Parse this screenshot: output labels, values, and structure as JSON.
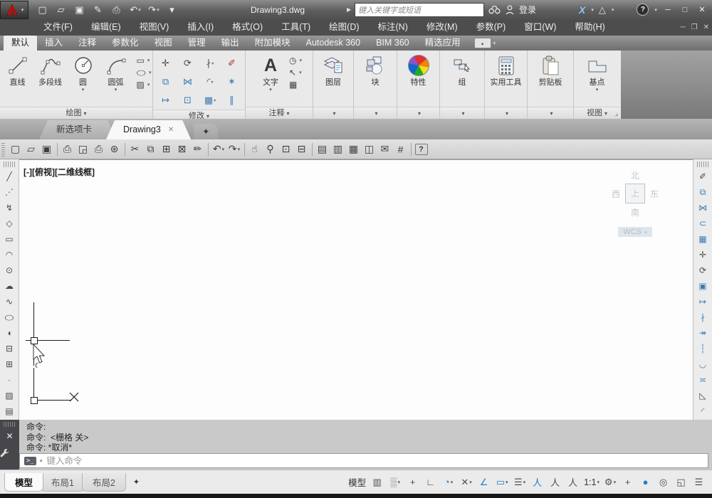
{
  "icons": {
    "caret": "▾",
    "corner": "⌟",
    "star": "✦",
    "ribbon_collapse": "▴",
    "prompt": "&gt;_",
    "prompt_text": ">_",
    "expand_arrow": "▶"
  },
  "titlebar": {
    "title": "Drawing3.dwg",
    "search_placeholder": "键入关键字或短语",
    "signin": "登录",
    "quick_access": [
      {
        "name": "new-file-icon",
        "glyph": "▢"
      },
      {
        "name": "open-file-icon",
        "glyph": "▱"
      },
      {
        "name": "save-icon",
        "glyph": "▣"
      },
      {
        "name": "save-as-icon",
        "glyph": "✎"
      },
      {
        "name": "print-icon",
        "glyph": "⎙"
      },
      {
        "name": "undo-icon",
        "glyph": "↶",
        "caret": "▾"
      },
      {
        "name": "redo-icon",
        "glyph": "↷",
        "caret": "▾"
      },
      {
        "name": "qat-customize-icon",
        "glyph": "▾"
      }
    ],
    "window_controls": [
      {
        "name": "minimize-button",
        "glyph": "─"
      },
      {
        "name": "maximize-button",
        "glyph": "□"
      },
      {
        "name": "close-button",
        "glyph": "✕"
      }
    ]
  },
  "menu": {
    "items": [
      "文件(F)",
      "编辑(E)",
      "视图(V)",
      "插入(I)",
      "格式(O)",
      "工具(T)",
      "绘图(D)",
      "标注(N)",
      "修改(M)",
      "参数(P)",
      "窗口(W)",
      "帮助(H)"
    ],
    "doc_controls": [
      {
        "name": "doc-minimize-button",
        "glyph": "─"
      },
      {
        "name": "doc-restore-button",
        "glyph": "❐"
      },
      {
        "name": "doc-close-button",
        "glyph": "✕"
      }
    ]
  },
  "ribbon": {
    "tabs": [
      {
        "label": "默认",
        "cls": "active"
      },
      {
        "label": "插入"
      },
      {
        "label": "注释"
      },
      {
        "label": "参数化"
      },
      {
        "label": "视图"
      },
      {
        "label": "管理"
      },
      {
        "label": "输出"
      },
      {
        "label": "附加模块"
      },
      {
        "label": "Autodesk 360"
      },
      {
        "label": "BIM 360"
      },
      {
        "label": "精选应用"
      }
    ],
    "panels": {
      "draw": {
        "label": "绘图",
        "line": "直线",
        "polyline": "多段线",
        "circle": "圆",
        "arc": "圆弧",
        "small": [
          {
            "name": "rectangle-icon",
            "glyph": "▭"
          },
          {
            "name": "ellipse-icon",
            "glyph": "◯",
            "cls": "squash"
          },
          {
            "name": "hatch-icon",
            "glyph": "▨"
          }
        ]
      },
      "modify": {
        "label": "修改",
        "tools": [
          {
            "name": "move-icon",
            "glyph": "✛"
          },
          {
            "name": "rotate-icon",
            "glyph": "⟳"
          },
          {
            "name": "trim-icon",
            "glyph": "∤",
            "caret": "▾"
          },
          {
            "name": "erase-icon",
            "glyph": "✐",
            "cls": "red"
          },
          {
            "name": "copy-icon",
            "glyph": "⧉",
            "cls": "blue"
          },
          {
            "name": "mirror-icon",
            "glyph": "⋈",
            "cls": "blue"
          },
          {
            "name": "fillet-icon",
            "glyph": "◜",
            "caret": "▾"
          },
          {
            "name": "explode-icon",
            "glyph": "✶",
            "cls": "blue"
          },
          {
            "name": "stretch-icon",
            "glyph": "↦",
            "cls": "blue"
          },
          {
            "name": "scale-icon",
            "glyph": "⊡",
            "cls": "blue"
          },
          {
            "name": "array-icon",
            "glyph": "▦",
            "cls": "blue",
            "caret": "▾"
          },
          {
            "name": "offset-icon",
            "glyph": "∥",
            "cls": "blue"
          }
        ]
      },
      "annotate": {
        "label": "注释",
        "text_label": "文字",
        "small": [
          {
            "name": "dimension-icon",
            "glyph": "◷",
            "caret": "▾"
          },
          {
            "name": "multileader-icon",
            "glyph": "↖",
            "caret": "▾"
          },
          {
            "name": "table-icon",
            "glyph": "▦"
          }
        ]
      },
      "layers": {
        "label": "图层"
      },
      "block": {
        "label": "块"
      },
      "properties": {
        "label": "特性"
      },
      "group": {
        "label": "组"
      },
      "utilities": {
        "label": "实用工具"
      },
      "clipboard": {
        "label": "剪贴板"
      },
      "view": {
        "label": "视图",
        "base_label": "基点"
      }
    }
  },
  "file_tabs": {
    "tabs": [
      {
        "label": "新选项卡"
      },
      {
        "label": "Drawing3",
        "cls": "active",
        "close": "✕"
      }
    ]
  },
  "toolbar": {
    "items": [
      {
        "name": "new-icon",
        "glyph": "▢"
      },
      {
        "name": "open-icon",
        "glyph": "▱"
      },
      {
        "name": "save-icon",
        "glyph": "▣"
      },
      {
        "name": "toolbar-separator",
        "cls": "sep"
      },
      {
        "name": "print-icon",
        "glyph": "⎙"
      },
      {
        "name": "print-preview-icon",
        "glyph": "◲"
      },
      {
        "name": "plot-icon",
        "glyph": "⎙"
      },
      {
        "name": "publish-icon",
        "glyph": "⊛"
      },
      {
        "name": "toolbar-separator",
        "cls": "sep"
      },
      {
        "name": "cut-icon",
        "glyph": "✂"
      },
      {
        "name": "copy-clip-icon",
        "glyph": "⧉"
      },
      {
        "name": "paste-icon",
        "glyph": "⊞"
      },
      {
        "name": "paste-special-icon",
        "glyph": "⊠"
      },
      {
        "name": "match-properties-icon",
        "glyph": "✏"
      },
      {
        "name": "toolbar-separator",
        "cls": "sep"
      },
      {
        "name": "undo-icon",
        "glyph": "↶",
        "caret": "▾"
      },
      {
        "name": "redo-icon",
        "glyph": "↷",
        "caret": "▾"
      },
      {
        "name": "toolbar-separator",
        "cls": "sep"
      },
      {
        "name": "pan-icon",
        "glyph": "☝"
      },
      {
        "name": "zoom-realtime-icon",
        "glyph": "⚲"
      },
      {
        "name": "zoom-window-icon",
        "glyph": "⊡"
      },
      {
        "name": "zoom-previous-icon",
        "glyph": "⊟"
      },
      {
        "name": "toolbar-separator",
        "cls": "sep"
      },
      {
        "name": "properties-palette-icon",
        "glyph": "▤"
      },
      {
        "name": "designcenter-icon",
        "glyph": "▥"
      },
      {
        "name": "tool-palettes-icon",
        "glyph": "▦"
      },
      {
        "name": "sheet-set-manager-icon",
        "glyph": "◫"
      },
      {
        "name": "markup-set-manager-icon",
        "glyph": "✉"
      },
      {
        "name": "quickcalc-icon",
        "glyph": "#"
      },
      {
        "name": "toolbar-separator",
        "cls": "sep"
      },
      {
        "name": "help-icon",
        "glyph": "?",
        "cls": "boxed"
      }
    ]
  },
  "left_toolbar": {
    "items": [
      {
        "name": "line-icon",
        "glyph": "╱"
      },
      {
        "name": "construction-line-icon",
        "glyph": "⋰"
      },
      {
        "name": "polyline-icon",
        "glyph": "↯"
      },
      {
        "name": "polygon-icon",
        "glyph": "◇"
      },
      {
        "name": "rectangle-icon",
        "glyph": "▭"
      },
      {
        "name": "arc-icon",
        "glyph": "◠"
      },
      {
        "name": "circle-icon",
        "glyph": "⊙"
      },
      {
        "name": "revision-cloud-icon",
        "glyph": "☁"
      },
      {
        "name": "spline-icon",
        "glyph": "∿"
      },
      {
        "name": "ellipse-icon",
        "glyph": "◯",
        "cls": "squash"
      },
      {
        "name": "ellipse-arc-icon",
        "glyph": "◖"
      },
      {
        "name": "insert-block-icon",
        "glyph": "⊟"
      },
      {
        "name": "make-block-icon",
        "glyph": "⊞"
      },
      {
        "name": "point-icon",
        "glyph": "∙"
      },
      {
        "name": "hatch-icon",
        "glyph": "▨"
      },
      {
        "name": "gradient-icon",
        "glyph": "▤"
      }
    ]
  },
  "right_toolbar": {
    "items": [
      {
        "name": "erase-icon",
        "glyph": "✐"
      },
      {
        "name": "copy-icon",
        "glyph": "⧉",
        "cls": "blue"
      },
      {
        "name": "mirror-icon",
        "glyph": "⋈",
        "cls": "blue"
      },
      {
        "name": "offset-icon",
        "glyph": "⊂",
        "cls": "blue"
      },
      {
        "name": "array-icon",
        "glyph": "▦",
        "cls": "blue"
      },
      {
        "name": "move-icon",
        "glyph": "✛"
      },
      {
        "name": "rotate-icon",
        "glyph": "⟳"
      },
      {
        "name": "scale-icon",
        "glyph": "▣",
        "cls": "blue"
      },
      {
        "name": "stretch-icon",
        "glyph": "↦",
        "cls": "blue"
      },
      {
        "name": "trim-icon",
        "glyph": "∤",
        "cls": "blue"
      },
      {
        "name": "extend-icon",
        "glyph": "↠",
        "cls": "blue"
      },
      {
        "name": "break-at-point-icon",
        "glyph": "┆",
        "cls": "blue"
      },
      {
        "name": "break-icon",
        "glyph": "◡",
        "cls": "blue"
      },
      {
        "name": "join-icon",
        "glyph": "≍",
        "cls": "blue"
      },
      {
        "name": "chamfer-icon",
        "glyph": "◺"
      },
      {
        "name": "fillet-icon",
        "glyph": "◜",
        "cls": "blue"
      }
    ]
  },
  "canvas": {
    "viewport_label": "[-][俯视][二维线框]",
    "viewcube": {
      "north": "北",
      "south": "南",
      "west": "西",
      "east": "东",
      "top": "上",
      "wcs": "WCS"
    }
  },
  "command": {
    "history": [
      "命令:",
      "命令:  <栅格 关>",
      "命令: *取消*"
    ],
    "input_placeholder": "键入命令"
  },
  "status": {
    "layout_tabs": [
      {
        "label": "模型",
        "cls": "active"
      },
      {
        "label": "布局1"
      },
      {
        "label": "布局2"
      }
    ],
    "items": [
      {
        "name": "model-space-label",
        "glyph": "模型",
        "cls": "st-text"
      },
      {
        "name": "grid-display-icon",
        "glyph": "▥"
      },
      {
        "name": "snap-mode-icon",
        "glyph": "▒",
        "cls": "dim",
        "caret": "▾"
      },
      {
        "name": "snap-icon",
        "glyph": "+"
      },
      {
        "name": "ortho-icon",
        "glyph": "∟"
      },
      {
        "name": "polar-tracking-icon",
        "glyph": "◔",
        "cls": "blue",
        "caret": "▾"
      },
      {
        "name": "object-snap-icon",
        "glyph": "✕",
        "caret": "▾"
      },
      {
        "name": "object-snap-tracking-icon",
        "glyph": "∠",
        "cls": "blue"
      },
      {
        "name": "dynamic-input-icon",
        "glyph": "▭",
        "cls": "blue",
        "caret": "▾"
      },
      {
        "name": "lineweight-icon",
        "glyph": "☰",
        "caret": "▾"
      },
      {
        "name": "annotation-visibility-icon",
        "glyph": "人",
        "cls": "blue"
      },
      {
        "name": "annotation-autoscale-icon",
        "glyph": "人"
      },
      {
        "name": "annotation-scale-icon",
        "glyph": "人"
      },
      {
        "name": "annotation-scale-value",
        "glyph": "1:1",
        "cls": "st-text",
        "caret": "▾"
      },
      {
        "name": "workspace-switching-icon",
        "glyph": "⚙",
        "caret": "▾"
      },
      {
        "name": "selection-cycling-icon",
        "glyph": "+"
      },
      {
        "name": "hardware-acceleration-icon",
        "glyph": "●",
        "cls": "bluefill"
      },
      {
        "name": "isolate-objects-icon",
        "glyph": "◎"
      },
      {
        "name": "clean-screen-icon",
        "glyph": "◱"
      },
      {
        "name": "customization-icon",
        "glyph": "☰"
      }
    ]
  }
}
